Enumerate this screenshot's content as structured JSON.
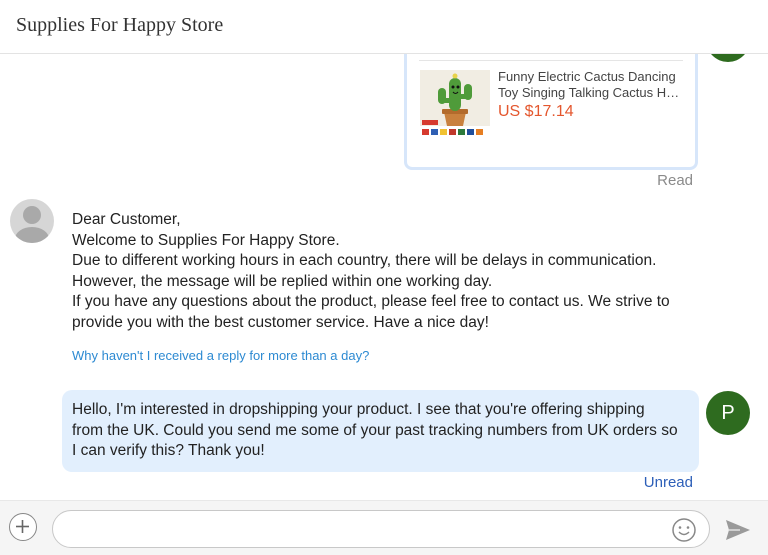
{
  "header": {
    "title": "Supplies For Happy Store"
  },
  "product": {
    "name_line1": "Funny Electric Cactus Dancing",
    "name_line2": "Toy Singing Talking Cactus H…",
    "price": "US $17.14",
    "status": "Read"
  },
  "incoming_message": {
    "lines": [
      "Dear Customer,",
      "Welcome to Supplies For Happy Store.",
      "Due to different working hours in each country, there will be delays in communication.",
      "However, the message will be replied within one working day.",
      "If you have any questions about the product, please feel free to contact us. We strive to",
      "provide you with the best customer service. Have a nice day!"
    ],
    "faq_link": "Why haven't I received a reply for more than a day?"
  },
  "outgoing_message": {
    "lines": [
      "Hello, I'm interested in dropshipping your product. I see that you're offering shipping",
      "from the UK. Could you send me some of your past tracking numbers from UK orders so",
      "I can verify this? Thank you!"
    ],
    "avatar_letter": "P",
    "status": "Unread"
  },
  "composer": {
    "value": "",
    "icons": {
      "attach": "plus-icon",
      "emoji": "emoji-icon",
      "send": "send-icon"
    }
  },
  "colors": {
    "price": "#e4572e",
    "link": "#2d8ad2",
    "outgoing_bubble": "#e2effd",
    "avatar_green": "#2e6b1f",
    "unread": "#2d5fb8"
  }
}
